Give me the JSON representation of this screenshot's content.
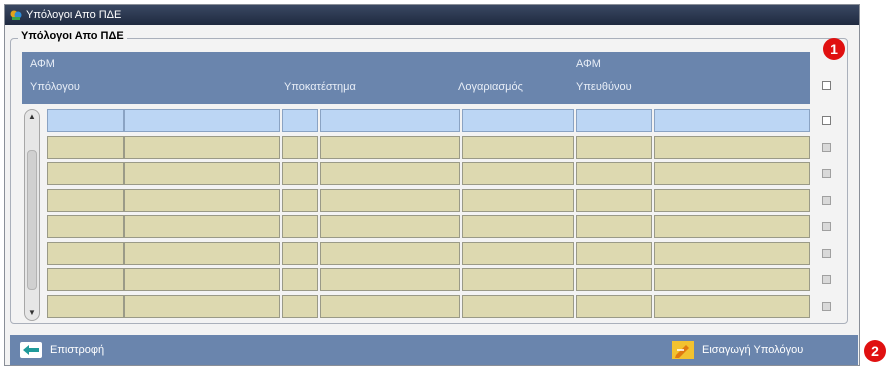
{
  "window": {
    "title": "Υπόλογοι Απο ΠΔΕ"
  },
  "group": {
    "label": "Υπόλογοι Απο ΠΔΕ"
  },
  "table": {
    "headers": {
      "afm_label": "ΑΦΜ",
      "ypologou": "Υπόλογου",
      "ypokatastima": "Υποκατέστημα",
      "logariasmos": "Λογαριασμός",
      "afm2_label": "ΑΦΜ",
      "ypefthynou": "Υπευθύνου"
    },
    "row_count": 8,
    "selected_row": 1
  },
  "footer": {
    "back_label": "Επιστροφή",
    "insert_label": "Εισαγωγή Υπολόγου"
  },
  "markers": {
    "one": "1",
    "two": "2"
  },
  "colors": {
    "header_bg": "#6a85ad",
    "row_bg": "#ddd9b0",
    "selected_row_bg": "#bcd6f4",
    "marker": "#e01010"
  },
  "icons": {
    "window": "app-icon",
    "back": "back-arrow-icon",
    "insert": "pencil-icon"
  }
}
